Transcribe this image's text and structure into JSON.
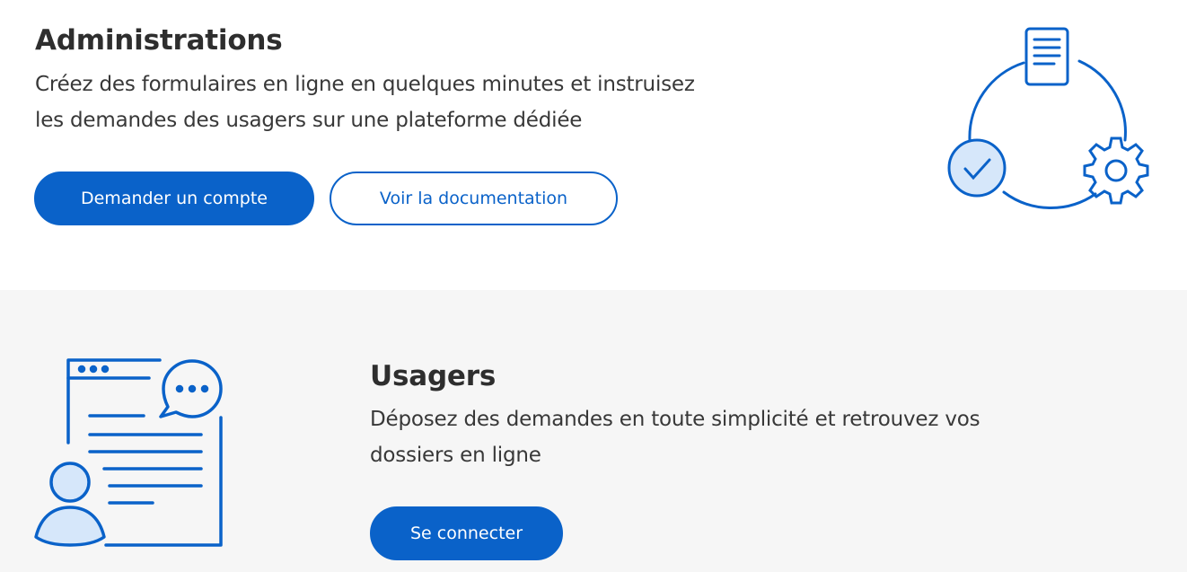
{
  "administrations": {
    "title": "Administrations",
    "description_line1": "Créez des formulaires en ligne en quelques minutes et instruisez",
    "description_line2": "les demandes des usagers sur une plateforme dédiée",
    "primary_button": "Demander un compte",
    "secondary_button": "Voir la documentation",
    "illustration_icons": [
      "document-icon",
      "check-circle-icon",
      "gear-icon",
      "cycle-icon"
    ]
  },
  "usagers": {
    "title": "Usagers",
    "description_line1": "Déposez des demandes en toute simplicité et retrouvez vos",
    "description_line2": "dossiers en ligne",
    "primary_button": "Se connecter",
    "illustration_icons": [
      "browser-window-icon",
      "chat-bubble-icon",
      "user-icon"
    ]
  },
  "colors": {
    "accent": "#0a62c9",
    "accent_light": "#d6e7fa",
    "section_alt_background": "#f6f6f6",
    "text": "#333333"
  }
}
